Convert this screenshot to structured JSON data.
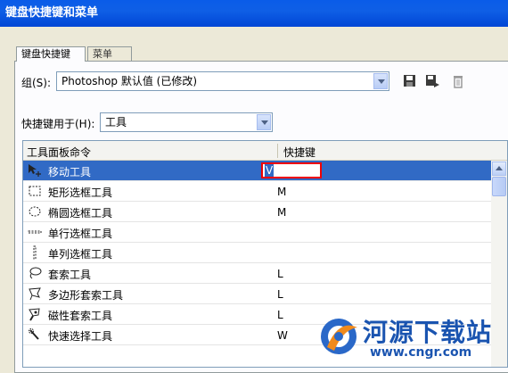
{
  "window": {
    "title": "键盘快捷键和菜单"
  },
  "tabs": [
    {
      "label": "键盘快捷键",
      "active": true
    },
    {
      "label": "菜单",
      "active": false
    }
  ],
  "set": {
    "label": "组(S):",
    "value": "Photoshop 默认值 (已修改)"
  },
  "shortcuts_for": {
    "label": "快捷键用于(H):",
    "value": "工具"
  },
  "table": {
    "columns": [
      "工具面板命令",
      "快捷键"
    ],
    "rows": [
      {
        "name": "移动工具",
        "shortcut": "V",
        "icon": "move-tool-icon",
        "selected": true,
        "editing": true
      },
      {
        "name": "矩形选框工具",
        "shortcut": "M",
        "icon": "rect-marquee-icon"
      },
      {
        "name": "椭圆选框工具",
        "shortcut": "M",
        "icon": "ellipse-marquee-icon"
      },
      {
        "name": "单行选框工具",
        "shortcut": "",
        "icon": "single-row-marquee-icon"
      },
      {
        "name": "单列选框工具",
        "shortcut": "",
        "icon": "single-column-marquee-icon"
      },
      {
        "name": "套索工具",
        "shortcut": "L",
        "icon": "lasso-icon"
      },
      {
        "name": "多边形套索工具",
        "shortcut": "L",
        "icon": "polygon-lasso-icon"
      },
      {
        "name": "磁性套索工具",
        "shortcut": "L",
        "icon": "magnetic-lasso-icon"
      },
      {
        "name": "快速选择工具",
        "shortcut": "W",
        "icon": "quick-selection-icon"
      }
    ]
  },
  "watermark": {
    "text": "河源下载站",
    "url": "www.cngr.com"
  },
  "colors": {
    "titlebar": "#0a5ce8",
    "selection": "#316ac5",
    "edit_border": "#e00000"
  }
}
